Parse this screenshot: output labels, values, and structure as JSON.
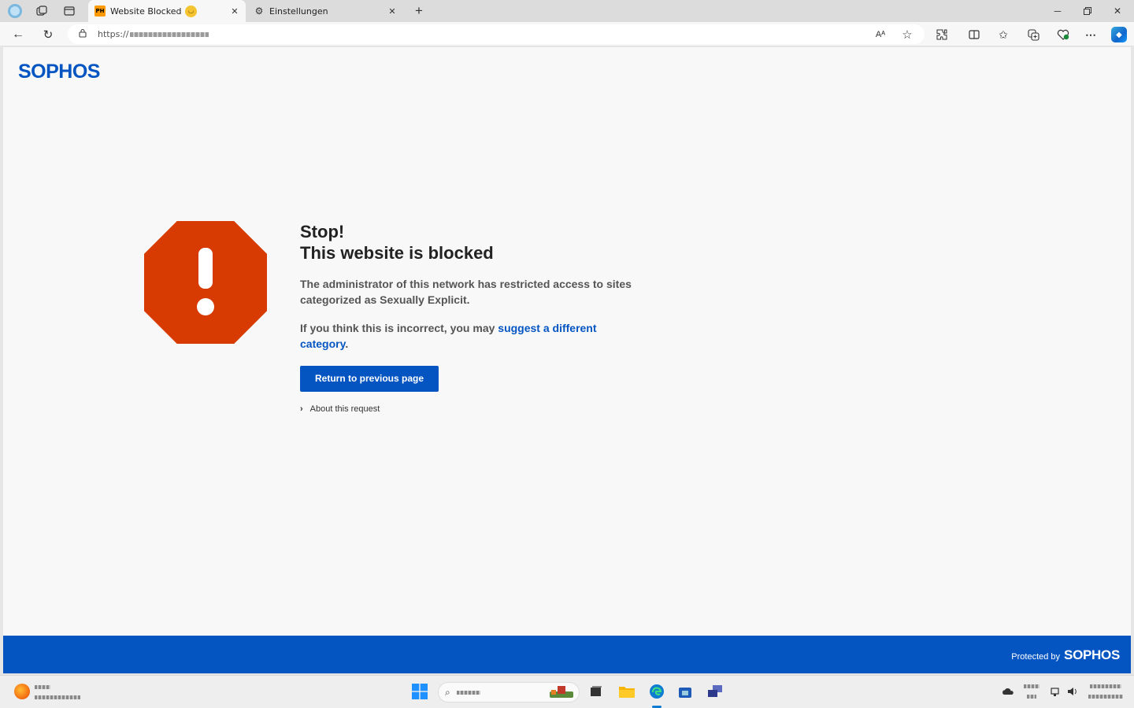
{
  "browser": {
    "tabs": [
      {
        "favicon": "PH",
        "title": "Website Blocked",
        "active": true
      },
      {
        "favicon": "gear-icon",
        "title": "Einstellungen",
        "active": false
      }
    ],
    "url": "https://",
    "new_tab_label": "+",
    "read_aloud_label": "Aᴬ"
  },
  "page": {
    "brand": "SOPHOS",
    "title_line1": "Stop!",
    "title_line2": "This website is blocked",
    "message": "The administrator of this network has restricted access to sites categorized as Sexually Explicit.",
    "suggest_prefix": "If you think this is incorrect, you may ",
    "suggest_link": "suggest a different category",
    "suggest_suffix": ".",
    "return_button": "Return to previous page",
    "about_link": "About this request",
    "footer_label": "Protected by",
    "footer_brand": "SOPHOS"
  },
  "colors": {
    "brand_blue": "#0455c2",
    "stop_red": "#d83b01",
    "page_bg": "#f8f8f8"
  }
}
